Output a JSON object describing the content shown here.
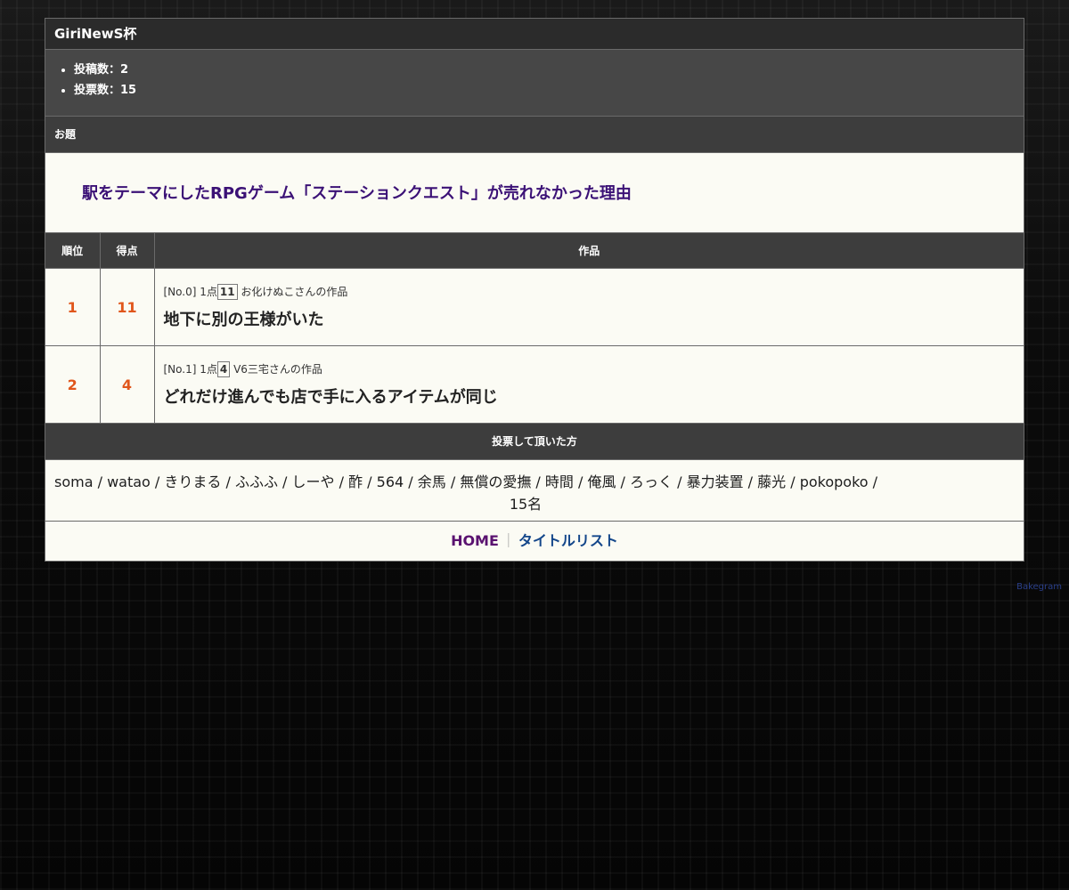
{
  "contest": {
    "title": "GiriNewS杯",
    "stats": [
      "投稿数：2",
      "投票数：15"
    ]
  },
  "odai": {
    "heading": "お題",
    "text": "駅をテーマにしたRPGゲーム「ステーションクエスト」が売れなかった理由"
  },
  "results": {
    "headers": {
      "rank": "順位",
      "score": "得点",
      "work": "作品"
    },
    "rows": [
      {
        "rank": "1",
        "score": "11",
        "meta_prefix": "[No.0] 1点",
        "meta_points": "11",
        "meta_author": "お化けぬこさんの作品",
        "title": "地下に別の王様がいた"
      },
      {
        "rank": "2",
        "score": "4",
        "meta_prefix": "[No.1] 1点",
        "meta_points": "4",
        "meta_author": "V6三宅さんの作品",
        "title": "どれだけ進んでも店で手に入るアイテムが同じ"
      }
    ]
  },
  "voters": {
    "heading": "投票して頂いた方",
    "list": "soma / watao / きりまる / ふふふ / しーや / 酢 / 564 / 余馬 / 無償の愛撫 / 時間 / 俺風 / ろっく / 暴力装置 / 藤光 / pokopoko /",
    "count": "15名"
  },
  "nav": {
    "home": "HOME",
    "separator": "｜",
    "title_list": "タイトルリスト"
  },
  "credit": "Bakegram"
}
